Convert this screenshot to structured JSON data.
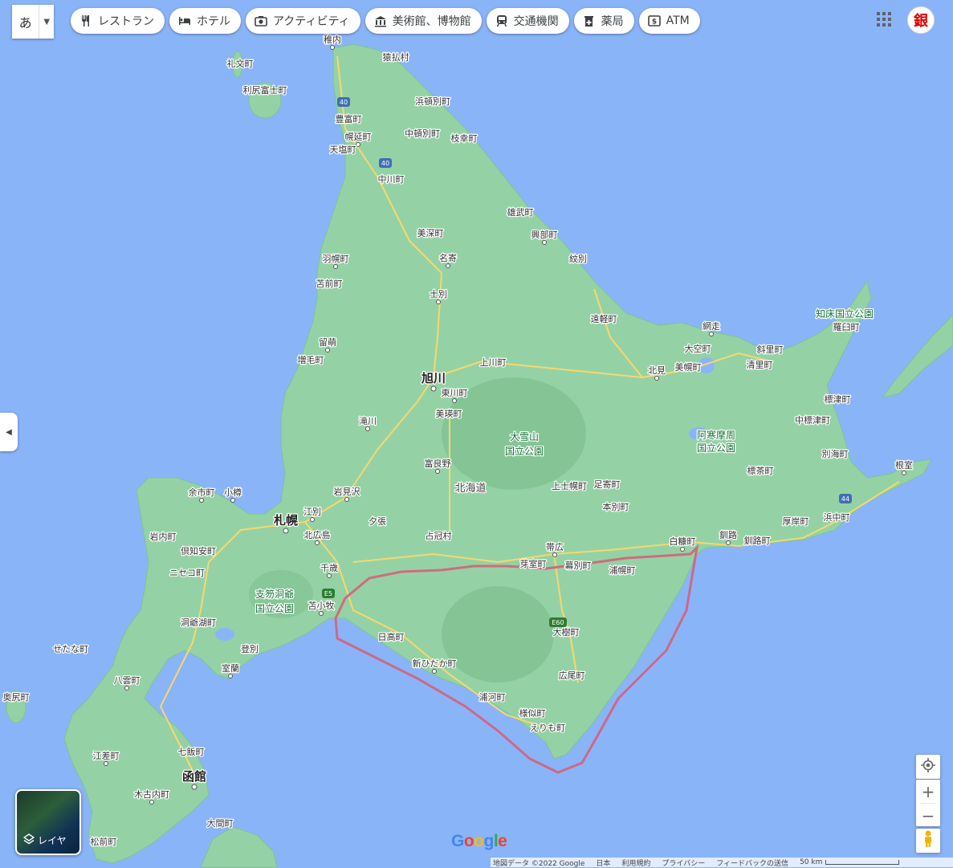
{
  "map": {
    "colors": {
      "water": "#8ab4f8",
      "land": "#94d2a5",
      "mountain": "#7fbf8f",
      "road": "#f9d76b",
      "route": "#d4607a"
    },
    "labels_main": [
      "札幌",
      "旭川",
      "函館"
    ],
    "labels": [
      "稚内",
      "猿払村",
      "礼文町",
      "利尻富士町",
      "浜頓別町",
      "豊富町",
      "幌延町",
      "中頓別町",
      "枝幸町",
      "天塩町",
      "中川町",
      "雄武町",
      "興部町",
      "美深町",
      "紋別",
      "羽幌町",
      "名寄",
      "苫前町",
      "士別",
      "遠軽町",
      "網走",
      "大空町",
      "斜里町",
      "羅臼町",
      "留萌",
      "増毛町",
      "上川町",
      "北見",
      "美幌町",
      "清里町",
      "東川町",
      "美瑛町",
      "滝川",
      "標津町",
      "中標津町",
      "富良野",
      "別海町",
      "上士幌町",
      "足寄町",
      "標茶町",
      "根室",
      "余市町",
      "小樽",
      "岩見沢",
      "本別町",
      "江別",
      "北広島",
      "夕張",
      "占冠村",
      "帯広",
      "白糠町",
      "釧路",
      "釧路町",
      "厚岸町",
      "浜中町",
      "岩内町",
      "倶知安町",
      "ニセコ町",
      "千歳",
      "芽室町",
      "幕別町",
      "浦幌町",
      "苫小牧",
      "洞爺湖町",
      "日高町",
      "大樹町",
      "せたな町",
      "登別",
      "室蘭",
      "新ひだか町",
      "広尾町",
      "八雲町",
      "浦河町",
      "奥尻町",
      "様似町",
      "えりも町",
      "江差町",
      "七飯町",
      "木古内町",
      "大間町",
      "松前町"
    ],
    "parks": [
      "知床国立公園",
      "大雪山",
      "国立公園",
      "阿寒摩周",
      "国立公園",
      "支笏洞爺",
      "国立公園"
    ],
    "region": "北海道",
    "road_shields": [
      "40",
      "40",
      "E5",
      "E60",
      "44"
    ]
  },
  "search": {
    "lang_label": "あ"
  },
  "categories": [
    {
      "label": "レストラン",
      "icon": "restaurant-icon"
    },
    {
      "label": "ホテル",
      "icon": "hotel-icon"
    },
    {
      "label": "アクティビティ",
      "icon": "camera-icon"
    },
    {
      "label": "美術館、博物館",
      "icon": "museum-icon"
    },
    {
      "label": "交通機関",
      "icon": "train-icon"
    },
    {
      "label": "薬局",
      "icon": "pharmacy-icon"
    },
    {
      "label": "ATM",
      "icon": "atm-icon"
    }
  ],
  "avatar_text": "銀",
  "layers_label": "レイヤ",
  "logo": "Google",
  "footer": {
    "map_data": "地図データ ©2022 Google",
    "country": "日本",
    "terms": "利用規約",
    "privacy": "プライバシー",
    "feedback": "フィードバックの送信",
    "scale": "50 km"
  }
}
